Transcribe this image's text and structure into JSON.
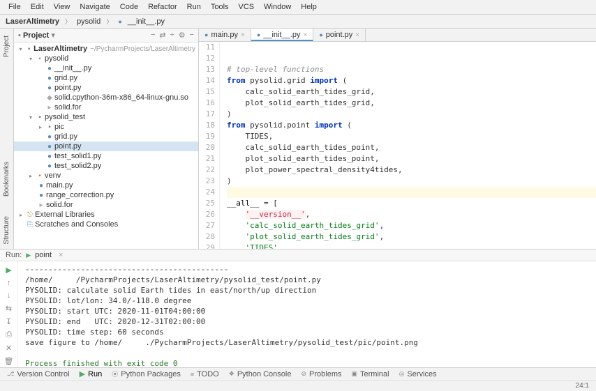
{
  "menu": [
    "File",
    "Edit",
    "View",
    "Navigate",
    "Code",
    "Refactor",
    "Run",
    "Tools",
    "VCS",
    "Window",
    "Help"
  ],
  "nav": {
    "proj": "LaserAltimetry",
    "crumb1": "pysolid",
    "crumb2": "__init__.py"
  },
  "project_panel": {
    "title": "Project",
    "tools": [
      "−",
      "⇄",
      "÷",
      "⚙",
      "−"
    ]
  },
  "tree": {
    "root": "LaserAltimetry",
    "root_dim": "~/PycharmProjects/LaserAltimetry",
    "pysolid": "pysolid",
    "init": "__init__.py",
    "grid": "grid.py",
    "point": "point.py",
    "so": "solid.cpython-36m-x86_64-linux-gnu.so",
    "for": "solid.for",
    "pytest": "pysolid_test",
    "pic": "pic",
    "tgrid": "grid.py",
    "tpoint": "point.py",
    "ts1": "test_solid1.py",
    "ts2": "test_solid2.py",
    "venv": "venv",
    "main": "main.py",
    "range": "range_correction.py",
    "sfor": "solid.for",
    "ext": "External Libraries",
    "scratch": "Scratches and Consoles"
  },
  "tabs": [
    {
      "label": "main.py",
      "active": false
    },
    {
      "label": "__init__.py",
      "active": true
    },
    {
      "label": "point.py",
      "active": false
    }
  ],
  "code": {
    "lines": [
      {
        "n": 11,
        "t": ""
      },
      {
        "n": 12,
        "t": ""
      },
      {
        "n": 13,
        "cm": "# top-level functions"
      },
      {
        "n": 14,
        "kw1": "from",
        "mod": " pysolid.grid ",
        "kw2": "import",
        "tail": " ("
      },
      {
        "n": 15,
        "t": "    calc_solid_earth_tides_grid,"
      },
      {
        "n": 16,
        "t": "    plot_solid_earth_tides_grid,"
      },
      {
        "n": 17,
        "t": ")"
      },
      {
        "n": 18,
        "kw1": "from",
        "mod": " pysolid.point ",
        "kw2": "import",
        "tail": " ("
      },
      {
        "n": 19,
        "t": "    TIDES,"
      },
      {
        "n": 20,
        "t": "    calc_solid_earth_tides_point,"
      },
      {
        "n": 21,
        "t": "    plot_solid_earth_tides_point,"
      },
      {
        "n": 22,
        "t": "    plot_power_spectral_density4tides,"
      },
      {
        "n": 23,
        "t": ")"
      },
      {
        "n": 24,
        "hl": true,
        "t": ""
      },
      {
        "n": 25,
        "all": "__all__",
        "tail": " = ["
      },
      {
        "n": 26,
        "warn": "'__version__'",
        "tail": ","
      },
      {
        "n": 27,
        "str": "'calc_solid_earth_tides_grid'",
        "tail": ","
      },
      {
        "n": 28,
        "str": "'plot_solid_earth_tides_grid'",
        "tail": ","
      },
      {
        "n": 29,
        "str": "'TIDES'",
        "tail": ","
      }
    ]
  },
  "run": {
    "label": "Run:",
    "cfg": "point",
    "out": {
      "dash": "--------------------------------------------",
      "l1a": "/home/",
      "l1b": "/PycharmProjects/LaserAltimetry/pysolid_test/point.py",
      "l2": "PYSOLID: calculate solid Earth tides in east/north/up direction",
      "l3": "PYSOLID: lot/lon: 34.0/-118.0 degree",
      "l4": "PYSOLID: start UTC: 2020-11-01T04:00:00",
      "l5": "PYSOLID: end   UTC: 2020-12-31T02:00:00",
      "l6": "PYSOLID: time step: 60 seconds",
      "l7a": "save figure to /home/",
      "l7b": "./PycharmProjects/LaserAltimetry/pysolid_test/pic/point.png",
      "exit": "Process finished with exit code 0"
    }
  },
  "side_rails": {
    "left_top": "Project",
    "left_mid": "Bookmarks",
    "left_bot": "Structure"
  },
  "bottom_tools": [
    "Version Control",
    "Run",
    "Python Packages",
    "TODO",
    "Python Console",
    "Problems",
    "Terminal",
    "Services"
  ],
  "status": {
    "pos": "24:1"
  }
}
